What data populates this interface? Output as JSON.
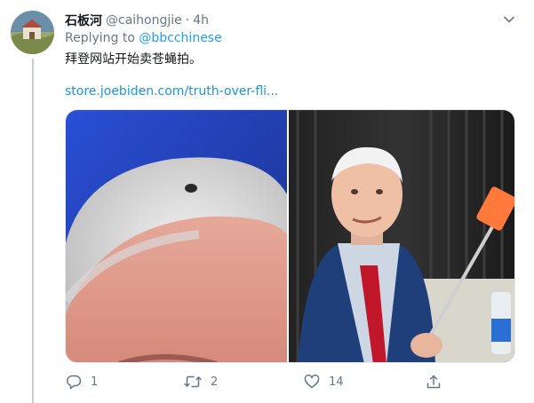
{
  "tweet": {
    "display_name": "石板河",
    "handle": "@caihongjie",
    "separator": "·",
    "time": "4h",
    "replying_prefix": "Replying to",
    "replying_to": "@bbcchinese",
    "text": "拜登网站开始卖苍蝇拍。",
    "link": "store.joebiden.com/truth-over-fli..."
  },
  "actions": {
    "reply_count": "1",
    "retweet_count": "2",
    "like_count": "14"
  },
  "colors": {
    "accent": "#1da1f2",
    "muted": "#657786",
    "text": "#14171a"
  },
  "icons": [
    "chevron-down-icon",
    "reply-icon",
    "retweet-icon",
    "like-icon",
    "share-icon"
  ]
}
